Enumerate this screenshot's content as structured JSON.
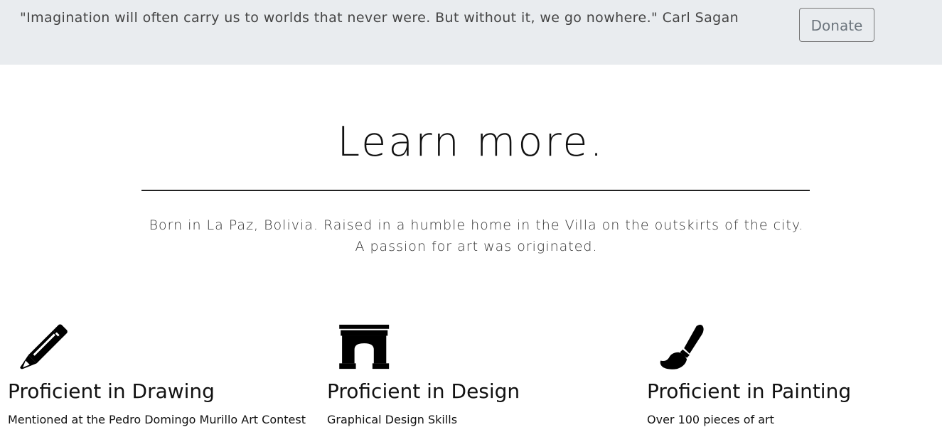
{
  "header": {
    "quote": "\"Imagination will often carry us to worlds that never were. But without it, we go nowhere.\" Carl Sagan",
    "donate_label": "Donate"
  },
  "about": {
    "title": "Learn more.",
    "bio": "Born in La Paz, Bolivia. Raised in a humble home in the Villa on the outskirts of the city. A passion for art was originated."
  },
  "features": [
    {
      "icon": "pencil-icon",
      "title": "Proficient in Drawing",
      "description": "Mentioned at the Pedro Domingo Murillo Art Contest"
    },
    {
      "icon": "archway-icon",
      "title": "Proficient in Design",
      "description": "Graphical Design Skills"
    },
    {
      "icon": "paint-brush-icon",
      "title": "Proficient in Painting",
      "description": "Over 100 pieces of art"
    }
  ]
}
